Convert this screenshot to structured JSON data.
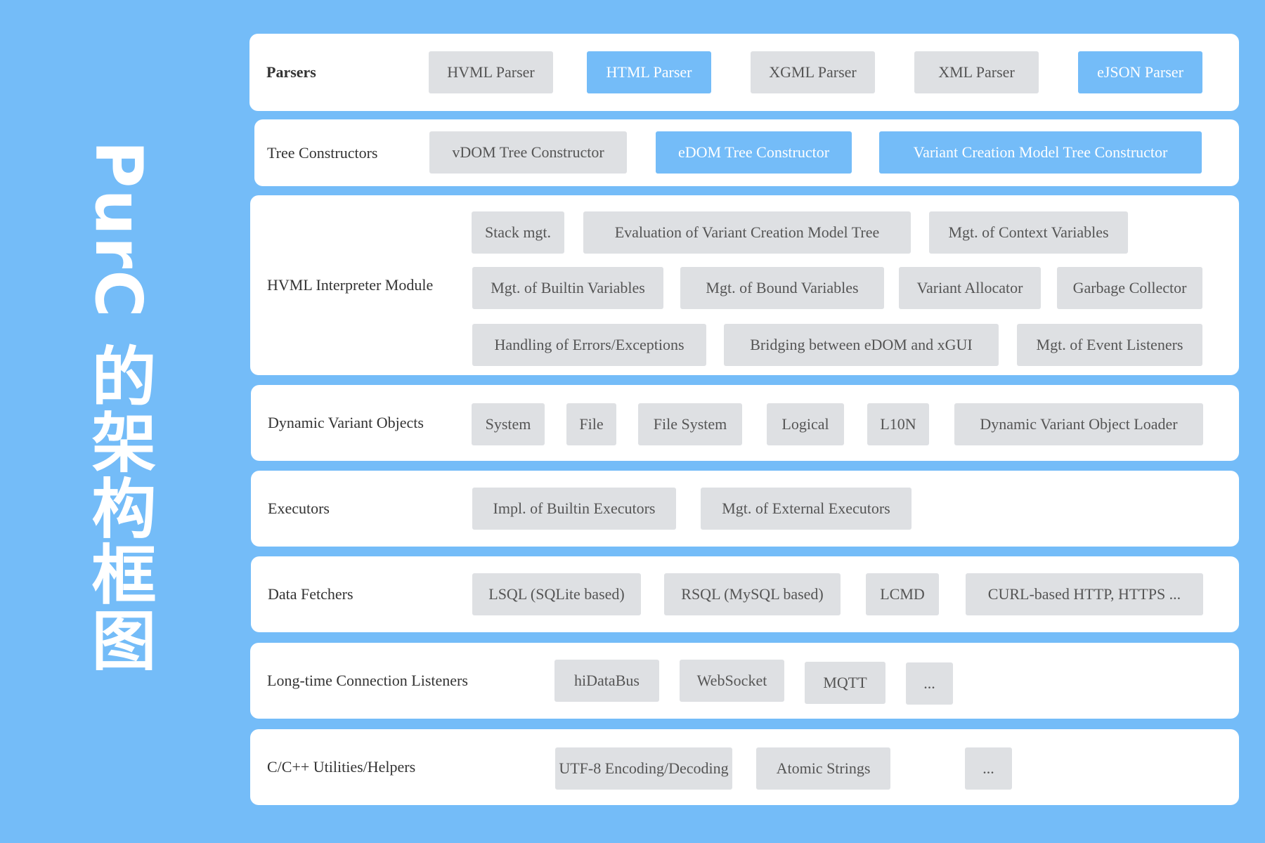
{
  "title": "PurC 的架构框图",
  "layers": {
    "parsers": {
      "label": "Parsers",
      "items": [
        "HVML Parser",
        "HTML Parser",
        "XGML Parser",
        "XML Parser",
        "eJSON Parser"
      ]
    },
    "tree": {
      "label": "Tree Constructors",
      "items": [
        "vDOM Tree Constructor",
        "eDOM Tree Constructor",
        "Variant Creation Model Tree Constructor"
      ]
    },
    "interp": {
      "label": "HVML Interpreter Module",
      "items": [
        "Stack mgt.",
        "Evaluation of Variant Creation Model Tree",
        "Mgt. of Context Variables",
        "Mgt. of Builtin Variables",
        "Mgt. of Bound Variables",
        "Variant Allocator",
        "Garbage Collector",
        "Handling of Errors/Exceptions",
        "Bridging between eDOM and xGUI",
        "Mgt. of Event Listeners"
      ]
    },
    "dvobjs": {
      "label": "Dynamic Variant Objects",
      "items": [
        "System",
        "File",
        "File System",
        "Logical",
        "L10N",
        "Dynamic Variant Object Loader"
      ]
    },
    "executors": {
      "label": "Executors",
      "items": [
        "Impl. of Builtin Executors",
        "Mgt. of External Executors"
      ]
    },
    "fetchers": {
      "label": "Data Fetchers",
      "items": [
        "LSQL (SQLite based)",
        "RSQL (MySQL based)",
        "LCMD",
        "CURL-based HTTP, HTTPS ..."
      ]
    },
    "listeners": {
      "label": "Long-time Connection Listeners",
      "items": [
        "hiDataBus",
        "WebSocket",
        "MQTT",
        "..."
      ]
    },
    "utils": {
      "label": "C/C++ Utilities/Helpers",
      "items": [
        "UTF-8 Encoding/Decoding",
        "Atomic Strings",
        "..."
      ]
    }
  },
  "colors": {
    "background": "#74bcf8",
    "panel": "#ffffff",
    "chip": "#dee0e3",
    "highlight": "#74bcf8",
    "title": "#ffffff"
  }
}
